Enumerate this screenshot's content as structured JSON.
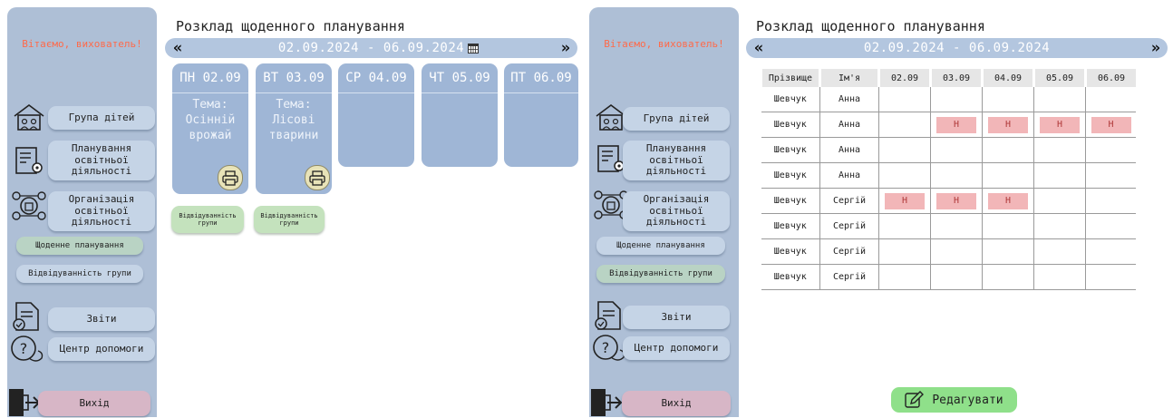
{
  "left": {
    "greeting": "Вітаємо, вихователь!",
    "nav": {
      "group": "Група дітей",
      "planning": [
        "Планування",
        "освітньої",
        "діяльності"
      ],
      "organization": [
        "Організація",
        "освітньої",
        "діяльності"
      ],
      "daily": "Щоденне планування",
      "attendance": "Відвідуванність групи",
      "reports": "Звіти",
      "help": "Центр допомоги",
      "exit": "Вихід"
    },
    "page_title": "Розклад щоденного планування",
    "date_range": "02.09.2024 - 06.09.2024",
    "prev_arrow": "«",
    "next_arrow": "»",
    "days": [
      {
        "label": "ПН 02.09",
        "topic": [
          "Тема:",
          "Осінній",
          "врожай"
        ]
      },
      {
        "label": "ВТ 03.09",
        "topic": [
          "Тема:",
          "Лісові",
          "тварини"
        ]
      },
      {
        "label": "СР 04.09",
        "topic": []
      },
      {
        "label": "ЧТ 05.09",
        "topic": []
      },
      {
        "label": "ПТ 06.09",
        "topic": []
      }
    ],
    "attendance_btn": [
      "Відвідуванність",
      "групи"
    ]
  },
  "right": {
    "greeting": "Вітаємо, вихователь!",
    "nav": {
      "group": "Група дітей",
      "planning": [
        "Планування",
        "освітньої",
        "діяльності"
      ],
      "organization": [
        "Організація",
        "освітньої",
        "діяльності"
      ],
      "daily": "Щоденне планування",
      "attendance": "Відвідуванність групи",
      "reports": "Звіти",
      "help": "Центр допомоги",
      "exit": "Вихід"
    },
    "page_title": "Розклад щоденного планування",
    "date_range": "02.09.2024 - 06.09.2024",
    "prev_arrow": "«",
    "next_arrow": "»",
    "table": {
      "headers": [
        "Прізвище",
        "Ім'я",
        "02.09",
        "03.09",
        "04.09",
        "05.09",
        "06.09"
      ],
      "rows": [
        {
          "surname": "Шевчук",
          "name": "Анна",
          "marks": [
            "",
            "",
            "",
            "",
            ""
          ]
        },
        {
          "surname": "Шевчук",
          "name": "Анна",
          "marks": [
            "",
            "Н",
            "Н",
            "Н",
            "Н"
          ]
        },
        {
          "surname": "Шевчук",
          "name": "Анна",
          "marks": [
            "",
            "",
            "",
            "",
            ""
          ]
        },
        {
          "surname": "Шевчук",
          "name": "Анна",
          "marks": [
            "",
            "",
            "",
            "",
            ""
          ]
        },
        {
          "surname": "Шевчук",
          "name": "Сергій",
          "marks": [
            "Н",
            "Н",
            "Н",
            "",
            ""
          ]
        },
        {
          "surname": "Шевчук",
          "name": "Сергій",
          "marks": [
            "",
            "",
            "",
            "",
            ""
          ]
        },
        {
          "surname": "Шевчук",
          "name": "Сергій",
          "marks": [
            "",
            "",
            "",
            "",
            ""
          ]
        },
        {
          "surname": "Шевчук",
          "name": "Сергій",
          "marks": [
            "",
            "",
            "",
            "",
            ""
          ]
        }
      ]
    },
    "edit_button": "Редагувати"
  }
}
